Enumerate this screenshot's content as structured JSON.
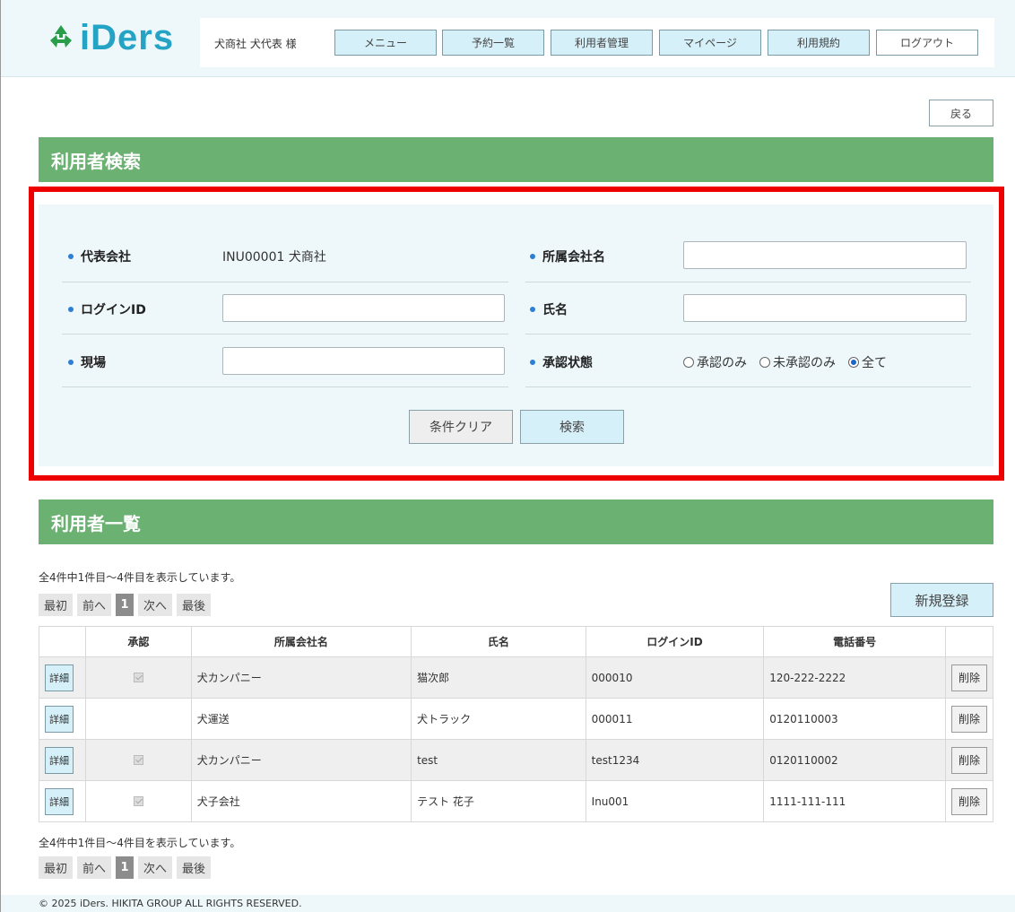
{
  "header": {
    "logo": "iDers",
    "user_name": "犬商社 犬代表 様",
    "nav": {
      "menu": "メニュー",
      "reservations": "予約一覧",
      "user_management": "利用者管理",
      "mypage": "マイページ",
      "terms": "利用規約",
      "logout": "ログアウト"
    }
  },
  "back_button": "戻る",
  "search": {
    "title": "利用者検索",
    "fields": {
      "rep_company_label": "代表会社",
      "rep_company_value": "INU00001 犬商社",
      "affiliated_company_label": "所属会社名",
      "login_id_label": "ログインID",
      "name_label": "氏名",
      "site_label": "現場",
      "approval_label": "承認状態"
    },
    "approval_options": {
      "approved": "承認のみ",
      "unapproved": "未承認のみ",
      "all": "全て",
      "selected": "全て"
    },
    "clear_button": "条件クリア",
    "search_button": "検索"
  },
  "list": {
    "title": "利用者一覧",
    "count_text": "全4件中1件目～4件目を表示しています。",
    "pager": {
      "first": "最初",
      "prev": "前へ",
      "current": "1",
      "next": "次へ",
      "last": "最後"
    },
    "new_button": "新規登録",
    "columns": {
      "approval": "承認",
      "company": "所属会社名",
      "name": "氏名",
      "login_id": "ログインID",
      "phone": "電話番号"
    },
    "detail_label": "詳細",
    "delete_label": "削除",
    "rows": [
      {
        "approved": true,
        "company": "犬カンパニー",
        "name": "猫次郎",
        "login_id": "000010",
        "phone": "120-222-2222"
      },
      {
        "approved": false,
        "company": "犬運送",
        "name": "犬トラック",
        "login_id": "000011",
        "phone": "0120110003"
      },
      {
        "approved": true,
        "company": "犬カンパニー",
        "name": "test",
        "login_id": "test1234",
        "phone": "0120110002"
      },
      {
        "approved": true,
        "company": "犬子会社",
        "name": "テスト 花子",
        "login_id": "Inu001",
        "phone": "1111-111-111"
      }
    ]
  },
  "footer": "© 2025 iDers. HIKITA GROUP ALL RIGHTS RESERVED."
}
